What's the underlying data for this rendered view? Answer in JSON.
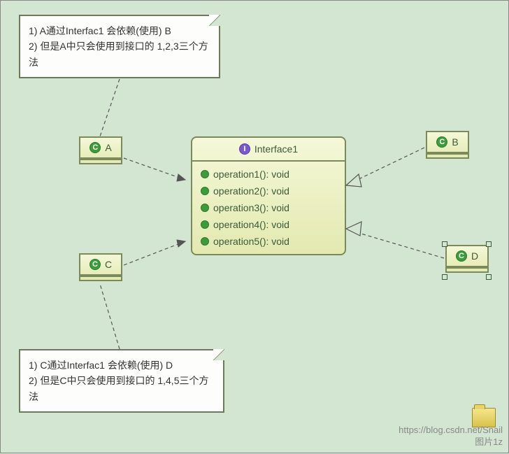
{
  "notes": {
    "top": {
      "line1": "1) A通过Interfac1 会依赖(使用) B",
      "line2": "2) 但是A中只会使用到接口的 1,2,3三个方法"
    },
    "bottom": {
      "line1": "1) C通过Interfac1 会依赖(使用) D",
      "line2": "2) 但是C中只会使用到接口的 1,4,5三个方法"
    }
  },
  "classes": {
    "a": {
      "name": "A",
      "icon": "C"
    },
    "b": {
      "name": "B",
      "icon": "C"
    },
    "c": {
      "name": "C",
      "icon": "C"
    },
    "d": {
      "name": "D",
      "icon": "C"
    }
  },
  "interface": {
    "name": "Interface1",
    "icon": "I",
    "ops": [
      {
        "sig": "operation1(): void"
      },
      {
        "sig": "operation2(): void"
      },
      {
        "sig": "operation3(): void"
      },
      {
        "sig": "operation4(): void"
      },
      {
        "sig": "operation5(): void"
      }
    ]
  },
  "watermark": {
    "url": "https://blog.csdn.net/Snail",
    "label": "图片1z"
  }
}
